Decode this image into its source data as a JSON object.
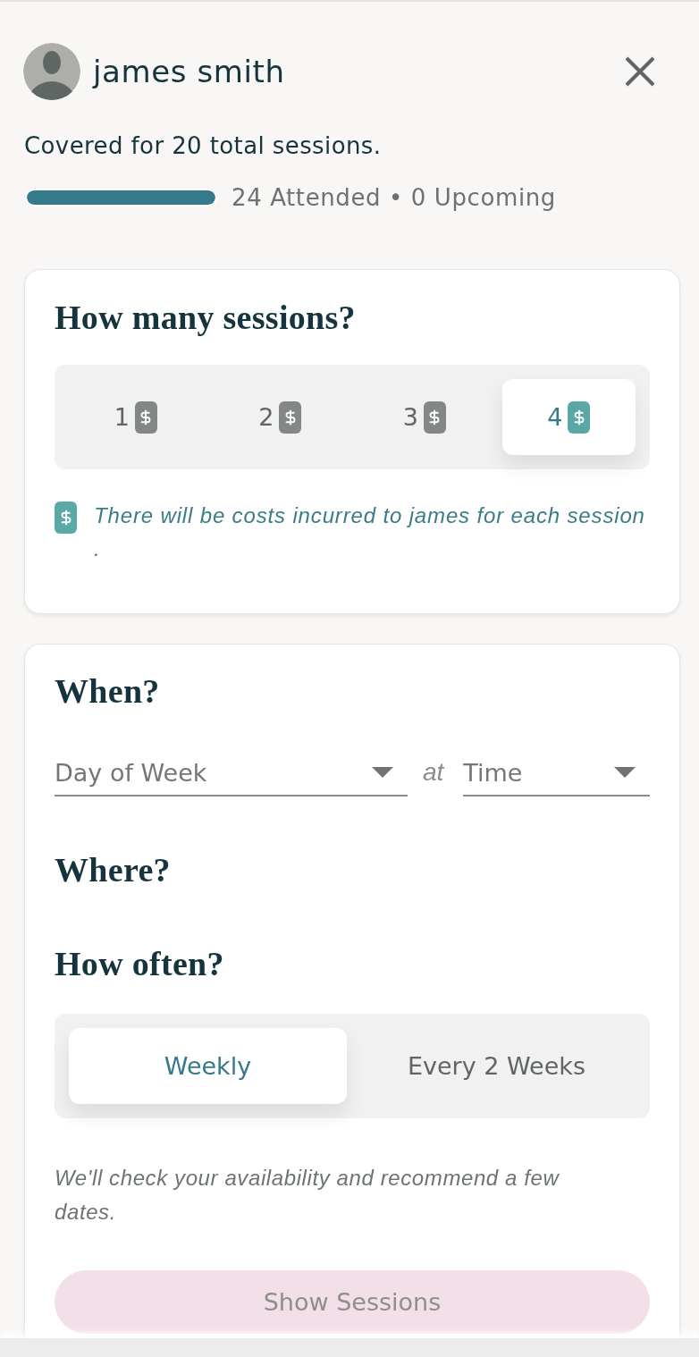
{
  "header": {
    "name": "james smith"
  },
  "coverage": {
    "summary": "Covered for 20 total sessions.",
    "level": 1,
    "counts": "24 Attended • 0 Upcoming"
  },
  "sessions": {
    "title": "How many sessions?",
    "options": [
      {
        "label": "1",
        "selected": false,
        "paid": true
      },
      {
        "label": "2",
        "selected": false,
        "paid": true
      },
      {
        "label": "3",
        "selected": false,
        "paid": true
      },
      {
        "label": "4",
        "selected": true,
        "paid": true
      }
    ],
    "note": {
      "lines": [
        "There will be costs incurred to james for each session",
        "."
      ]
    }
  },
  "schedule": {
    "when": {
      "title": "When?",
      "day": {
        "placeholder": "Day of Week"
      },
      "joiner": "at",
      "time": {
        "placeholder": "Time"
      }
    },
    "where": {
      "title": "Where?"
    },
    "how_often": {
      "title": "How often?",
      "options": [
        {
          "label": "Weekly",
          "selected": true
        },
        {
          "label": "Every 2 Weeks",
          "selected": false
        }
      ]
    },
    "hint": "We'll check your availability and recommend a few dates.",
    "button": {
      "label": "Show Sessions",
      "disabled": true
    }
  }
}
